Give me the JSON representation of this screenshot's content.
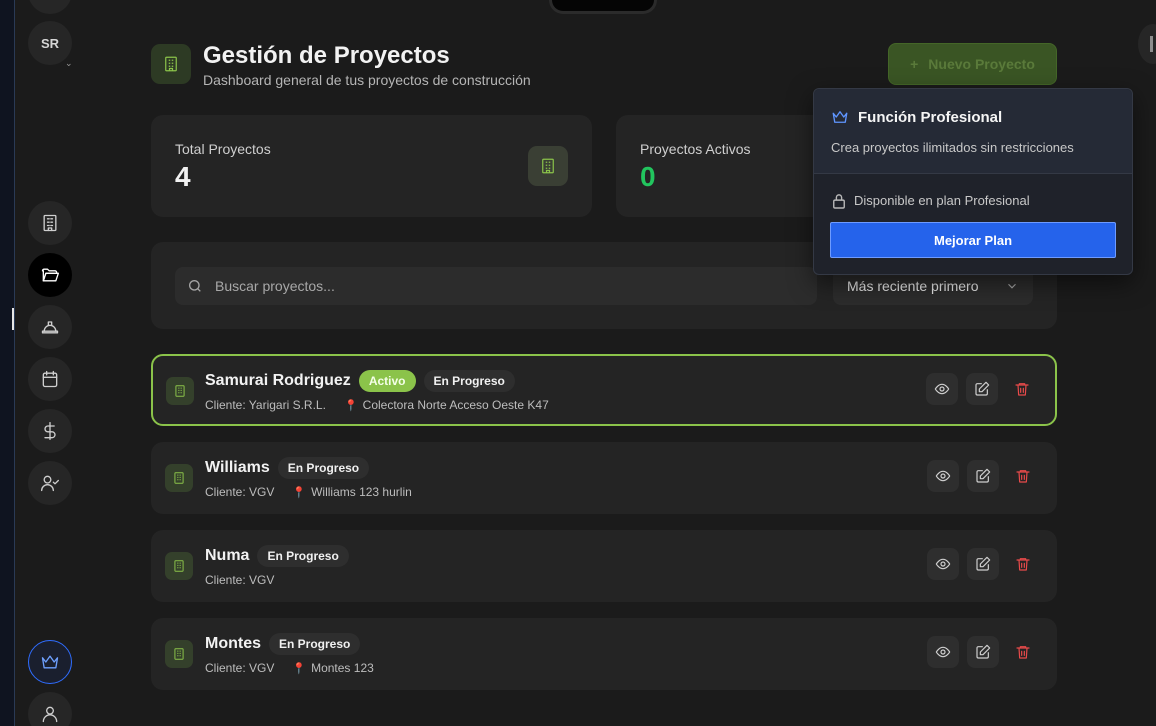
{
  "sidebar": {
    "avatar_initials": "SR"
  },
  "header": {
    "title": "Gestión de Proyectos",
    "subtitle": "Dashboard general de tus proyectos de construcción",
    "new_project_label": "Nuevo Proyecto"
  },
  "stats": [
    {
      "label": "Total Proyectos",
      "value": "4",
      "color": "#f2f2f2"
    },
    {
      "label": "Proyectos Activos",
      "value": "0",
      "color": "#22c55e"
    }
  ],
  "search": {
    "placeholder": "Buscar proyectos...",
    "sort_selected": "Más reciente primero"
  },
  "projects": [
    {
      "name": "Samurai Rodriguez",
      "active_badge": "Activo",
      "status": "En Progreso",
      "client": "Cliente: Yarigari S.R.L.",
      "location": "Colectora Norte Acceso Oeste K47"
    },
    {
      "name": "Williams",
      "status": "En Progreso",
      "client": "Cliente: VGV",
      "location": "Williams 123 hurlin"
    },
    {
      "name": "Numa",
      "status": "En Progreso",
      "client": "Cliente: VGV"
    },
    {
      "name": "Montes",
      "status": "En Progreso",
      "client": "Cliente: VGV",
      "location": "Montes 123"
    }
  ],
  "popover": {
    "title": "Función Profesional",
    "description": "Crea proyectos ilimitados sin restricciones",
    "availability": "Disponible en plan Profesional",
    "button_label": "Mejorar Plan"
  },
  "colors": {
    "accent_green": "#8bc34a",
    "upgrade_blue": "#2563eb",
    "delete_red": "#e84a4a"
  }
}
